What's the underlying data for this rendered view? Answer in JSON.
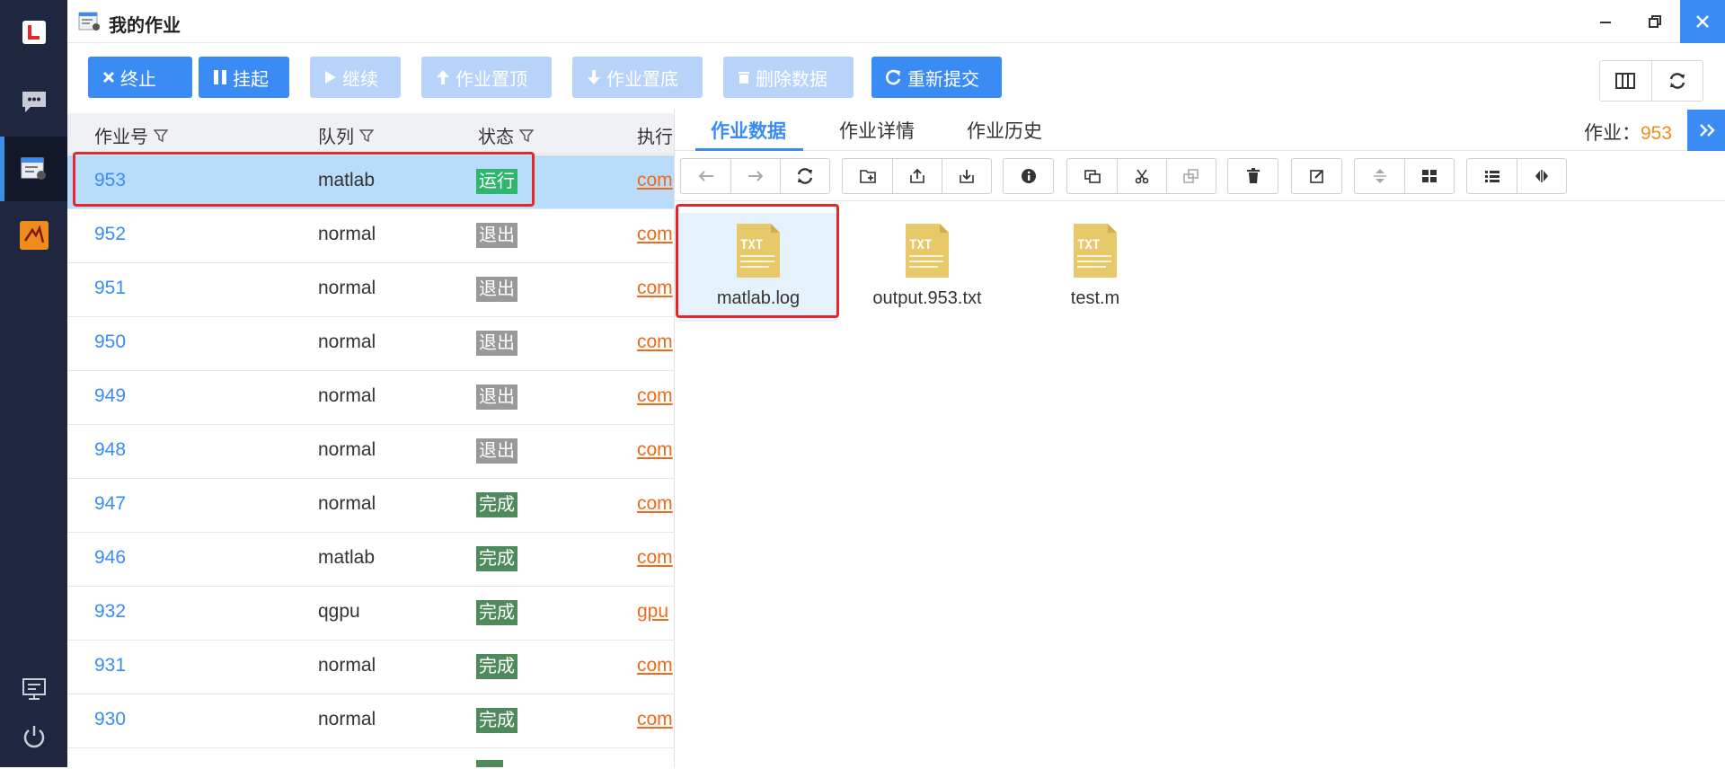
{
  "window": {
    "title": "我的作业"
  },
  "toolbar": {
    "terminate": "终止",
    "suspend": "挂起",
    "resume": "继续",
    "to_top": "作业置顶",
    "to_bottom": "作业置底",
    "delete_data": "删除数据",
    "resubmit": "重新提交"
  },
  "table": {
    "headers": {
      "id": "作业号",
      "queue": "队列",
      "status": "状态",
      "exec": "执行"
    },
    "rows": [
      {
        "id": "953",
        "queue": "matlab",
        "status": "运行",
        "status_type": "run",
        "exec": "com"
      },
      {
        "id": "952",
        "queue": "normal",
        "status": "退出",
        "status_type": "exit",
        "exec": "com"
      },
      {
        "id": "951",
        "queue": "normal",
        "status": "退出",
        "status_type": "exit",
        "exec": "com"
      },
      {
        "id": "950",
        "queue": "normal",
        "status": "退出",
        "status_type": "exit",
        "exec": "com"
      },
      {
        "id": "949",
        "queue": "normal",
        "status": "退出",
        "status_type": "exit",
        "exec": "com"
      },
      {
        "id": "948",
        "queue": "normal",
        "status": "退出",
        "status_type": "exit",
        "exec": "com"
      },
      {
        "id": "947",
        "queue": "normal",
        "status": "完成",
        "status_type": "done",
        "exec": "com"
      },
      {
        "id": "946",
        "queue": "matlab",
        "status": "完成",
        "status_type": "done",
        "exec": "com"
      },
      {
        "id": "932",
        "queue": "qgpu",
        "status": "完成",
        "status_type": "done",
        "exec": "gpu"
      },
      {
        "id": "931",
        "queue": "normal",
        "status": "完成",
        "status_type": "done",
        "exec": "com"
      },
      {
        "id": "930",
        "queue": "normal",
        "status": "完成",
        "status_type": "done",
        "exec": "com"
      }
    ]
  },
  "panel": {
    "tabs": [
      "作业数据",
      "作业详情",
      "作业历史"
    ],
    "job_label": "作业：",
    "job_id": "953",
    "file_badge": "TXT",
    "files": [
      "matlab.log",
      "output.953.txt",
      "test.m"
    ]
  },
  "colors": {
    "accent": "#3b8bf5",
    "rail": "#1f2640",
    "status_run": "#2fb56e",
    "status_exit": "#999999",
    "status_done": "#4e8a5c",
    "link": "#f06a1c",
    "highlight": "#e8262a"
  },
  "icons": {
    "rail": [
      "logo-icon",
      "chat-icon",
      "jobs-icon",
      "matlab-icon",
      "monitor-icon",
      "power-icon"
    ],
    "file_toolbar": [
      "back-icon",
      "forward-icon",
      "refresh-icon",
      "new-folder-icon",
      "upload-icon",
      "download-icon",
      "info-icon",
      "copy-icon",
      "cut-icon",
      "paste-icon",
      "delete-icon",
      "rename-icon",
      "sort-icon",
      "grid-view-icon",
      "list-view-icon",
      "split-icon"
    ]
  }
}
